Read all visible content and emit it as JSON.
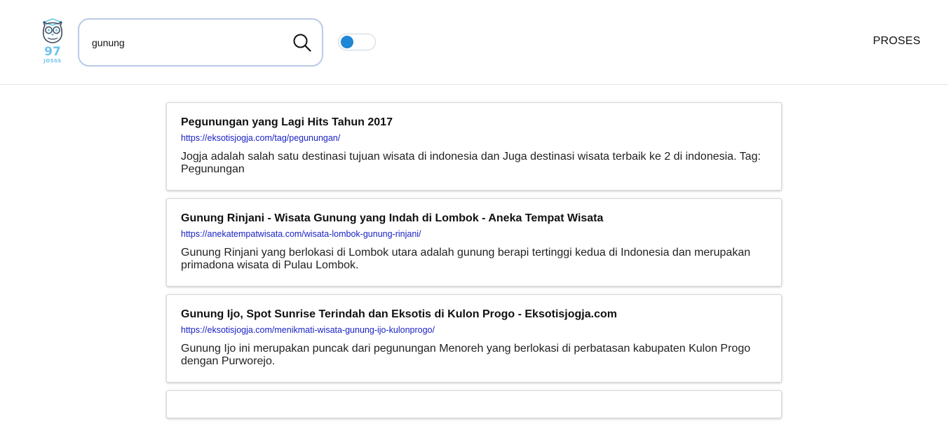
{
  "brand": {
    "logo_number": "97",
    "logo_text": "JOSSS"
  },
  "search": {
    "value": "gunung",
    "placeholder": ""
  },
  "toggle": {
    "state": "off"
  },
  "nav": {
    "proses_label": "PROSES"
  },
  "colors": {
    "accent": "#1e87d6",
    "url": "#1a22c4",
    "logo": "#6ec4ea",
    "search_border": "#b9cbe6"
  },
  "results": [
    {
      "title": "Pegunungan yang Lagi Hits Tahun 2017",
      "url": "https://eksotisjogja.com/tag/pegunungan/",
      "snippet": "Jogja adalah salah satu destinasi tujuan wisata di indonesia dan Juga destinasi wisata terbaik ke 2 di indonesia. Tag: Pegunungan"
    },
    {
      "title": "Gunung Rinjani - Wisata Gunung yang Indah di Lombok - Aneka Tempat Wisata",
      "url": "https://anekatempatwisata.com/wisata-lombok-gunung-rinjani/",
      "snippet": "Gunung Rinjani yang berlokasi di Lombok utara adalah gunung berapi tertinggi kedua di Indonesia dan merupakan primadona wisata di Pulau Lombok."
    },
    {
      "title": "Gunung Ijo, Spot Sunrise Terindah dan Eksotis di Kulon Progo - Eksotisjogja.com",
      "url": "https://eksotisjogja.com/menikmati-wisata-gunung-ijo-kulonprogo/",
      "snippet": "Gunung Ijo ini merupakan puncak dari pegunungan Menoreh yang berlokasi di perbatasan kabupaten Kulon Progo dengan Purworejo."
    }
  ]
}
